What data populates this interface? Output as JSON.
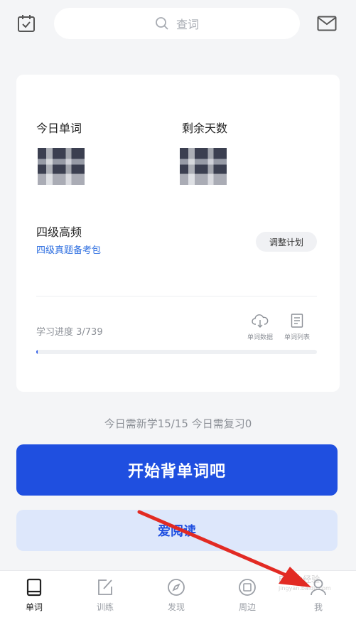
{
  "search": {
    "placeholder": "查词"
  },
  "card": {
    "today_words_label": "今日单词",
    "remaining_days_label": "剩余天数",
    "plan_title": "四级高频",
    "plan_subtitle": "四级真题备考包",
    "adjust_button": "调整计划",
    "progress_label": "学习进度 3/739",
    "progress_fraction": 0.004,
    "tools": [
      {
        "label": "单词数据",
        "icon": "cloud-download-icon"
      },
      {
        "label": "单词列表",
        "icon": "document-list-icon"
      }
    ]
  },
  "today_summary": "今日需新学15/15  今日需复习0",
  "start_button": "开始背单词吧",
  "read_button": "爱阅读",
  "tabs": [
    {
      "label": "单词",
      "icon": "book-icon",
      "active": true
    },
    {
      "label": "训练",
      "icon": "edit-icon",
      "active": false
    },
    {
      "label": "发现",
      "icon": "compass-icon",
      "active": false
    },
    {
      "label": "周边",
      "icon": "shop-icon",
      "active": false
    },
    {
      "label": "我",
      "icon": "profile-icon",
      "active": false
    }
  ],
  "watermark": {
    "title": "Baidu经验",
    "subtitle": "jingyan.baidu.com"
  },
  "colors": {
    "primary": "#1f4fe0",
    "link": "#2f6fe0",
    "background": "#f4f5f7"
  }
}
